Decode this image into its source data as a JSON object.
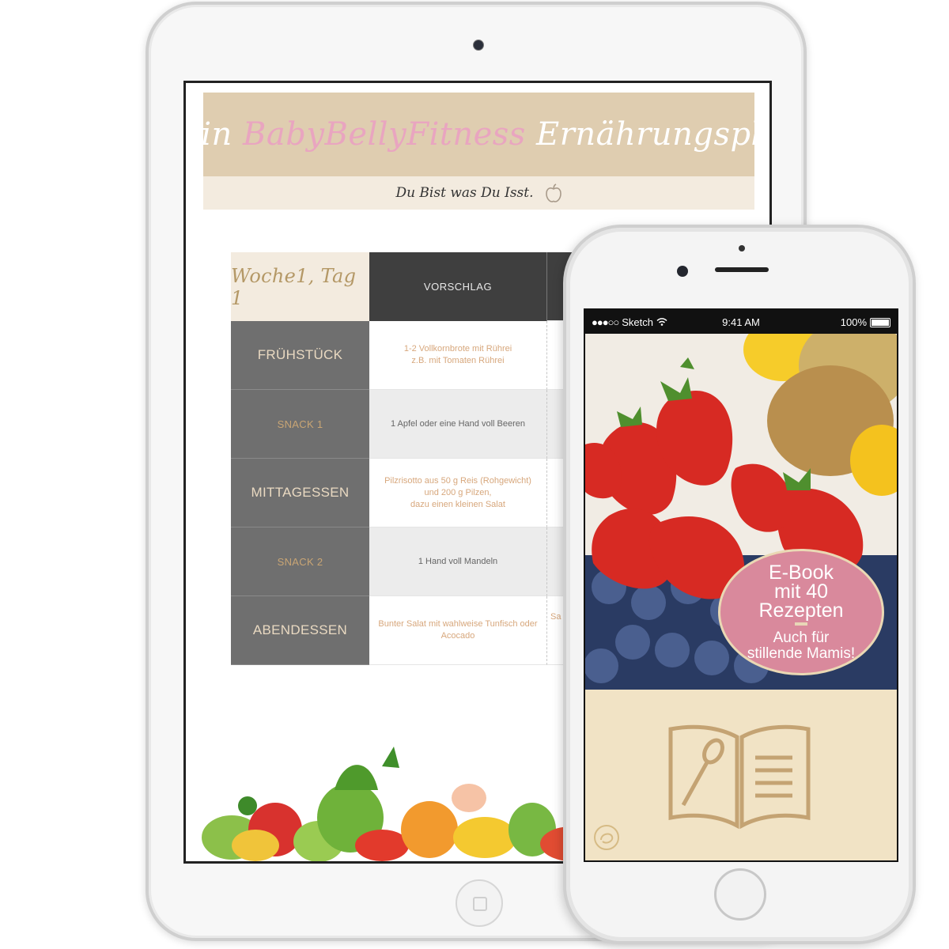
{
  "tablet": {
    "document": {
      "title_pre": "Dein",
      "title_brand": "BabyBellyFitness",
      "title_post": "Ernährungsplan",
      "motto": "Du Bist was Du Isst.",
      "table": {
        "day_label": "Woche1, Tag 1",
        "column_header": "VORSCHLAG",
        "rows": [
          {
            "meal": "FRÜHSTÜCK",
            "suggestion": "1-2 Vollkornbrote mit Rührei\nz.B. mit Tomaten Rührei"
          },
          {
            "meal": "SNACK 1",
            "suggestion": "1 Apfel oder eine Hand voll Beeren"
          },
          {
            "meal": "MITTAGESSEN",
            "suggestion": "Pilzrisotto aus 50 g Reis (Rohgewicht)\nund 200 g Pilzen,\ndazu einen kleinen Salat"
          },
          {
            "meal": "SNACK 2",
            "suggestion": "1 Hand voll Mandeln"
          },
          {
            "meal": "ABENDESSEN",
            "suggestion": "Bunter Salat mit wahlweise Tunfisch oder\nAcocado",
            "extra": "Sa"
          }
        ]
      }
    }
  },
  "phone": {
    "status_bar": {
      "carrier": "Sketch",
      "time": "9:41 AM",
      "battery": "100%"
    },
    "badge": {
      "title": "E-Book\nmit 40\nRezepten",
      "subtitle": "Auch für\nstillende Mamis!"
    },
    "icons": [
      "wifi-icon",
      "battery-icon",
      "recipe-book-icon",
      "apple-icon",
      "brand-logo-icon"
    ],
    "colors": {
      "header_beige": "#dfcdb0",
      "brand_pink": "#e9a5c0",
      "badge_pink": "#d9899c",
      "cream": "#f1e3c5",
      "gold": "#c9a574"
    }
  }
}
